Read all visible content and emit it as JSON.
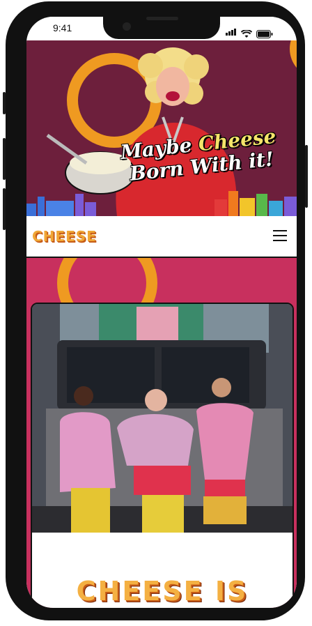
{
  "status_bar": {
    "time": "9:41"
  },
  "hero": {
    "script_line1_a": "Maybe ",
    "script_line1_b": "Cheese",
    "script_line2": "Born With it!"
  },
  "nav": {
    "logo": "CHEESE",
    "menu_icon": "hamburger-menu-icon"
  },
  "main": {
    "headline": "CHEESE IS"
  },
  "colors": {
    "hero_bg": "#6d1f3c",
    "accent_orange": "#ef9a21",
    "section_pink": "#c8305e",
    "logo_orange": "#f0a736"
  }
}
